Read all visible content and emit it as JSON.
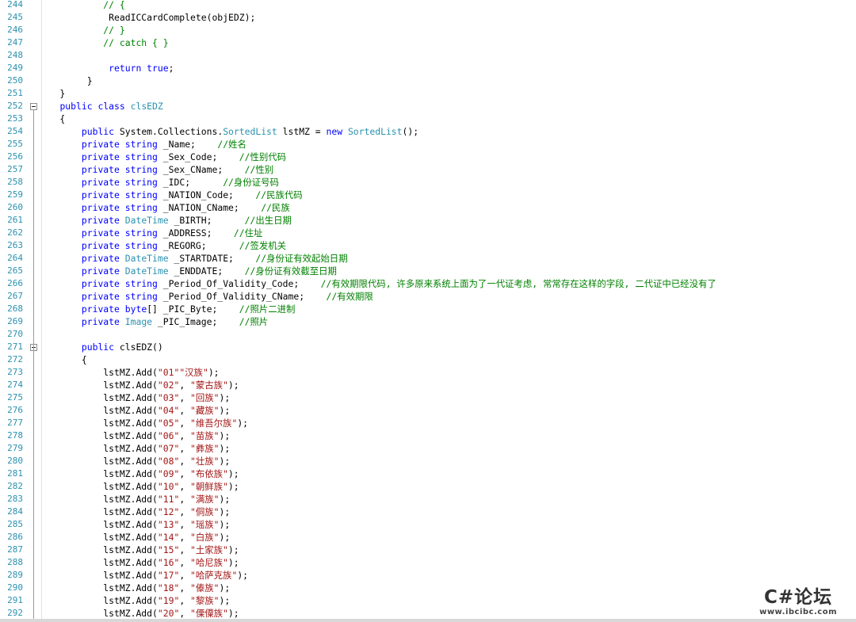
{
  "editor": {
    "lines": [
      {
        "n": "244",
        "tokens": [
          [
            "",
            "            "
          ],
          [
            "cm",
            "// {"
          ]
        ]
      },
      {
        "n": "245",
        "tokens": [
          [
            "",
            "             ReadICCardComplete(objEDZ);"
          ]
        ]
      },
      {
        "n": "246",
        "tokens": [
          [
            "",
            "            "
          ],
          [
            "cm",
            "// }"
          ]
        ]
      },
      {
        "n": "247",
        "tokens": [
          [
            "",
            "            "
          ],
          [
            "cm",
            "// catch { }"
          ]
        ]
      },
      {
        "n": "248",
        "tokens": []
      },
      {
        "n": "249",
        "tokens": [
          [
            "",
            "             "
          ],
          [
            "kw",
            "return"
          ],
          [
            "",
            " "
          ],
          [
            "kw",
            "true"
          ],
          [
            "",
            ";"
          ]
        ]
      },
      {
        "n": "250",
        "tokens": [
          [
            "",
            "         }"
          ]
        ]
      },
      {
        "n": "251",
        "tokens": [
          [
            "",
            "    }"
          ]
        ]
      },
      {
        "n": "252",
        "fold": true,
        "tokens": [
          [
            "",
            "    "
          ],
          [
            "kw",
            "public"
          ],
          [
            "",
            " "
          ],
          [
            "kw",
            "class"
          ],
          [
            "",
            " "
          ],
          [
            "ty",
            "clsEDZ"
          ]
        ]
      },
      {
        "n": "253",
        "tokens": [
          [
            "",
            "    {"
          ]
        ]
      },
      {
        "n": "254",
        "tokens": [
          [
            "",
            "        "
          ],
          [
            "kw",
            "public"
          ],
          [
            "",
            " System.Collections."
          ],
          [
            "ty",
            "SortedList"
          ],
          [
            "",
            " lstMZ = "
          ],
          [
            "kw",
            "new"
          ],
          [
            "",
            " "
          ],
          [
            "ty",
            "SortedList"
          ],
          [
            "",
            "();"
          ]
        ]
      },
      {
        "n": "255",
        "tokens": [
          [
            "",
            "        "
          ],
          [
            "kw",
            "private"
          ],
          [
            "",
            " "
          ],
          [
            "kw",
            "string"
          ],
          [
            "",
            " _Name;    "
          ],
          [
            "cm",
            "//姓名"
          ]
        ]
      },
      {
        "n": "256",
        "tokens": [
          [
            "",
            "        "
          ],
          [
            "kw",
            "private"
          ],
          [
            "",
            " "
          ],
          [
            "kw",
            "string"
          ],
          [
            "",
            " _Sex_Code;    "
          ],
          [
            "cm",
            "//性别代码"
          ]
        ]
      },
      {
        "n": "257",
        "tokens": [
          [
            "",
            "        "
          ],
          [
            "kw",
            "private"
          ],
          [
            "",
            " "
          ],
          [
            "kw",
            "string"
          ],
          [
            "",
            " _Sex_CName;    "
          ],
          [
            "cm",
            "//性别"
          ]
        ]
      },
      {
        "n": "258",
        "tokens": [
          [
            "",
            "        "
          ],
          [
            "kw",
            "private"
          ],
          [
            "",
            " "
          ],
          [
            "kw",
            "string"
          ],
          [
            "",
            " _IDC;      "
          ],
          [
            "cm",
            "//身份证号码"
          ]
        ]
      },
      {
        "n": "259",
        "tokens": [
          [
            "",
            "        "
          ],
          [
            "kw",
            "private"
          ],
          [
            "",
            " "
          ],
          [
            "kw",
            "string"
          ],
          [
            "",
            " _NATION_Code;    "
          ],
          [
            "cm",
            "//民族代码"
          ]
        ]
      },
      {
        "n": "260",
        "tokens": [
          [
            "",
            "        "
          ],
          [
            "kw",
            "private"
          ],
          [
            "",
            " "
          ],
          [
            "kw",
            "string"
          ],
          [
            "",
            " _NATION_CName;    "
          ],
          [
            "cm",
            "//民族"
          ]
        ]
      },
      {
        "n": "261",
        "tokens": [
          [
            "",
            "        "
          ],
          [
            "kw",
            "private"
          ],
          [
            "",
            " "
          ],
          [
            "ty",
            "DateTime"
          ],
          [
            "",
            " _BIRTH;      "
          ],
          [
            "cm",
            "//出生日期"
          ]
        ]
      },
      {
        "n": "262",
        "tokens": [
          [
            "",
            "        "
          ],
          [
            "kw",
            "private"
          ],
          [
            "",
            " "
          ],
          [
            "kw",
            "string"
          ],
          [
            "",
            " _ADDRESS;    "
          ],
          [
            "cm",
            "//住址"
          ]
        ]
      },
      {
        "n": "263",
        "tokens": [
          [
            "",
            "        "
          ],
          [
            "kw",
            "private"
          ],
          [
            "",
            " "
          ],
          [
            "kw",
            "string"
          ],
          [
            "",
            " _REGORG;      "
          ],
          [
            "cm",
            "//签发机关"
          ]
        ]
      },
      {
        "n": "264",
        "tokens": [
          [
            "",
            "        "
          ],
          [
            "kw",
            "private"
          ],
          [
            "",
            " "
          ],
          [
            "ty",
            "DateTime"
          ],
          [
            "",
            " _STARTDATE;    "
          ],
          [
            "cm",
            "//身份证有效起始日期"
          ]
        ]
      },
      {
        "n": "265",
        "tokens": [
          [
            "",
            "        "
          ],
          [
            "kw",
            "private"
          ],
          [
            "",
            " "
          ],
          [
            "ty",
            "DateTime"
          ],
          [
            "",
            " _ENDDATE;    "
          ],
          [
            "cm",
            "//身份证有效截至日期"
          ]
        ]
      },
      {
        "n": "266",
        "tokens": [
          [
            "",
            "        "
          ],
          [
            "kw",
            "private"
          ],
          [
            "",
            " "
          ],
          [
            "kw",
            "string"
          ],
          [
            "",
            " _Period_Of_Validity_Code;    "
          ],
          [
            "cm",
            "//有效期限代码, 许多原来系统上面为了一代证考虑, 常常存在这样的字段, 二代证中已经没有了"
          ]
        ]
      },
      {
        "n": "267",
        "tokens": [
          [
            "",
            "        "
          ],
          [
            "kw",
            "private"
          ],
          [
            "",
            " "
          ],
          [
            "kw",
            "string"
          ],
          [
            "",
            " _Period_Of_Validity_CName;    "
          ],
          [
            "cm",
            "//有效期限"
          ]
        ]
      },
      {
        "n": "268",
        "tokens": [
          [
            "",
            "        "
          ],
          [
            "kw",
            "private"
          ],
          [
            "",
            " "
          ],
          [
            "kw",
            "byte"
          ],
          [
            "",
            "[] _PIC_Byte;    "
          ],
          [
            "cm",
            "//照片二进制"
          ]
        ]
      },
      {
        "n": "269",
        "tokens": [
          [
            "",
            "        "
          ],
          [
            "kw",
            "private"
          ],
          [
            "",
            " "
          ],
          [
            "ty",
            "Image"
          ],
          [
            "",
            " _PIC_Image;    "
          ],
          [
            "cm",
            "//照片"
          ]
        ]
      },
      {
        "n": "270",
        "tokens": []
      },
      {
        "n": "271",
        "fold": true,
        "tokens": [
          [
            "",
            "        "
          ],
          [
            "kw",
            "public"
          ],
          [
            "",
            " clsEDZ()"
          ]
        ]
      },
      {
        "n": "272",
        "tokens": [
          [
            "",
            "        {"
          ]
        ]
      },
      {
        "n": "273",
        "tokens": [
          [
            "",
            "            lstMZ.Add("
          ],
          [
            "st",
            "\"01\""
          ],
          [
            ", ",
            ""
          ],
          [
            "st",
            "\"汉族\""
          ],
          [
            "",
            ");"
          ]
        ]
      },
      {
        "n": "274",
        "tokens": [
          [
            "",
            "            lstMZ.Add("
          ],
          [
            "st",
            "\"02\""
          ],
          [
            "",
            ", "
          ],
          [
            "st",
            "\"蒙古族\""
          ],
          [
            "",
            ");"
          ]
        ]
      },
      {
        "n": "275",
        "tokens": [
          [
            "",
            "            lstMZ.Add("
          ],
          [
            "st",
            "\"03\""
          ],
          [
            "",
            ", "
          ],
          [
            "st",
            "\"回族\""
          ],
          [
            "",
            ");"
          ]
        ]
      },
      {
        "n": "276",
        "tokens": [
          [
            "",
            "            lstMZ.Add("
          ],
          [
            "st",
            "\"04\""
          ],
          [
            "",
            ", "
          ],
          [
            "st",
            "\"藏族\""
          ],
          [
            "",
            ");"
          ]
        ]
      },
      {
        "n": "277",
        "tokens": [
          [
            "",
            "            lstMZ.Add("
          ],
          [
            "st",
            "\"05\""
          ],
          [
            "",
            ", "
          ],
          [
            "st",
            "\"维吾尔族\""
          ],
          [
            "",
            ");"
          ]
        ]
      },
      {
        "n": "278",
        "tokens": [
          [
            "",
            "            lstMZ.Add("
          ],
          [
            "st",
            "\"06\""
          ],
          [
            "",
            ", "
          ],
          [
            "st",
            "\"苗族\""
          ],
          [
            "",
            ");"
          ]
        ]
      },
      {
        "n": "279",
        "tokens": [
          [
            "",
            "            lstMZ.Add("
          ],
          [
            "st",
            "\"07\""
          ],
          [
            "",
            ", "
          ],
          [
            "st",
            "\"彝族\""
          ],
          [
            "",
            ");"
          ]
        ]
      },
      {
        "n": "280",
        "tokens": [
          [
            "",
            "            lstMZ.Add("
          ],
          [
            "st",
            "\"08\""
          ],
          [
            "",
            ", "
          ],
          [
            "st",
            "\"壮族\""
          ],
          [
            "",
            ");"
          ]
        ]
      },
      {
        "n": "281",
        "tokens": [
          [
            "",
            "            lstMZ.Add("
          ],
          [
            "st",
            "\"09\""
          ],
          [
            "",
            ", "
          ],
          [
            "st",
            "\"布依族\""
          ],
          [
            "",
            ");"
          ]
        ]
      },
      {
        "n": "282",
        "tokens": [
          [
            "",
            "            lstMZ.Add("
          ],
          [
            "st",
            "\"10\""
          ],
          [
            "",
            ", "
          ],
          [
            "st",
            "\"朝鲜族\""
          ],
          [
            "",
            ");"
          ]
        ]
      },
      {
        "n": "283",
        "tokens": [
          [
            "",
            "            lstMZ.Add("
          ],
          [
            "st",
            "\"11\""
          ],
          [
            "",
            ", "
          ],
          [
            "st",
            "\"满族\""
          ],
          [
            "",
            ");"
          ]
        ]
      },
      {
        "n": "284",
        "tokens": [
          [
            "",
            "            lstMZ.Add("
          ],
          [
            "st",
            "\"12\""
          ],
          [
            "",
            ", "
          ],
          [
            "st",
            "\"侗族\""
          ],
          [
            "",
            ");"
          ]
        ]
      },
      {
        "n": "285",
        "tokens": [
          [
            "",
            "            lstMZ.Add("
          ],
          [
            "st",
            "\"13\""
          ],
          [
            "",
            ", "
          ],
          [
            "st",
            "\"瑶族\""
          ],
          [
            "",
            ");"
          ]
        ]
      },
      {
        "n": "286",
        "tokens": [
          [
            "",
            "            lstMZ.Add("
          ],
          [
            "st",
            "\"14\""
          ],
          [
            "",
            ", "
          ],
          [
            "st",
            "\"白族\""
          ],
          [
            "",
            ");"
          ]
        ]
      },
      {
        "n": "287",
        "tokens": [
          [
            "",
            "            lstMZ.Add("
          ],
          [
            "st",
            "\"15\""
          ],
          [
            "",
            ", "
          ],
          [
            "st",
            "\"土家族\""
          ],
          [
            "",
            ");"
          ]
        ]
      },
      {
        "n": "288",
        "tokens": [
          [
            "",
            "            lstMZ.Add("
          ],
          [
            "st",
            "\"16\""
          ],
          [
            "",
            ", "
          ],
          [
            "st",
            "\"哈尼族\""
          ],
          [
            "",
            ");"
          ]
        ]
      },
      {
        "n": "289",
        "tokens": [
          [
            "",
            "            lstMZ.Add("
          ],
          [
            "st",
            "\"17\""
          ],
          [
            "",
            ", "
          ],
          [
            "st",
            "\"哈萨克族\""
          ],
          [
            "",
            ");"
          ]
        ]
      },
      {
        "n": "290",
        "tokens": [
          [
            "",
            "            lstMZ.Add("
          ],
          [
            "st",
            "\"18\""
          ],
          [
            "",
            ", "
          ],
          [
            "st",
            "\"傣族\""
          ],
          [
            "",
            ");"
          ]
        ]
      },
      {
        "n": "291",
        "tokens": [
          [
            "",
            "            lstMZ.Add("
          ],
          [
            "st",
            "\"19\""
          ],
          [
            "",
            ", "
          ],
          [
            "st",
            "\"黎族\""
          ],
          [
            "",
            ");"
          ]
        ]
      },
      {
        "n": "292",
        "tokens": [
          [
            "",
            "            lstMZ.Add("
          ],
          [
            "st",
            "\"20\""
          ],
          [
            "",
            ", "
          ],
          [
            "st",
            "\"傈僳族\""
          ],
          [
            "",
            ");"
          ]
        ]
      }
    ]
  },
  "watermark": {
    "title": "C#论坛",
    "url": "www.ibcibc.com"
  },
  "colors": {
    "keyword": "#0000ff",
    "type": "#2b91af",
    "comment": "#008000",
    "string": "#a31515",
    "line_number": "#2b91af"
  }
}
